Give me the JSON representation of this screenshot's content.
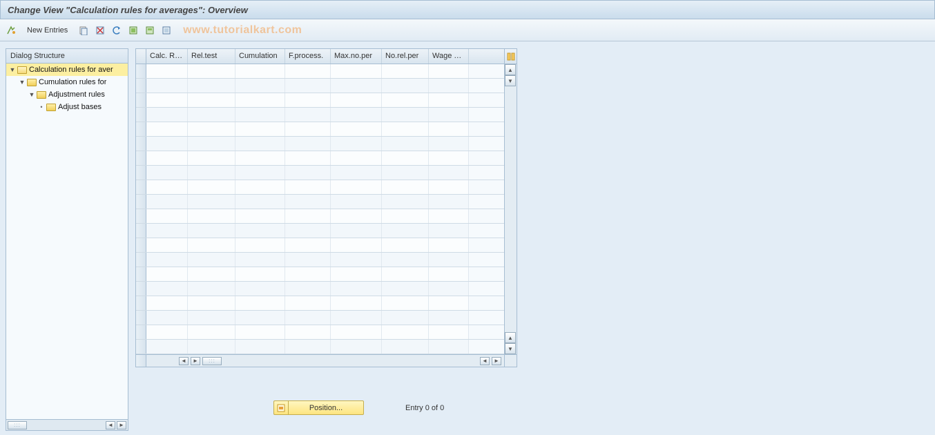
{
  "title": "Change View \"Calculation rules for averages\": Overview",
  "toolbar": {
    "new_entries_label": "New Entries"
  },
  "watermark": "www.tutorialkart.com",
  "sidebar": {
    "title": "Dialog Structure",
    "nodes": [
      {
        "label": "Calculation rules for aver",
        "level": 1,
        "selected": true,
        "expanded": true,
        "leaf": false
      },
      {
        "label": "Cumulation rules for",
        "level": 2,
        "selected": false,
        "expanded": true,
        "leaf": false
      },
      {
        "label": "Adjustment rules",
        "level": 3,
        "selected": false,
        "expanded": true,
        "leaf": false
      },
      {
        "label": "Adjust bases",
        "level": 4,
        "selected": false,
        "expanded": false,
        "leaf": true
      }
    ]
  },
  "table": {
    "columns": [
      {
        "label": "Calc. Rule",
        "cls": "col0"
      },
      {
        "label": "Rel.test",
        "cls": "col1"
      },
      {
        "label": "Cumulation",
        "cls": "col2"
      },
      {
        "label": "F.process.",
        "cls": "col3"
      },
      {
        "label": "Max.no.per",
        "cls": "col4"
      },
      {
        "label": "No.rel.per",
        "cls": "col5"
      },
      {
        "label": "Wage Ty...",
        "cls": "col6"
      }
    ],
    "row_count": 20
  },
  "footer": {
    "position_label": "Position...",
    "entry_label": "Entry 0 of 0"
  }
}
